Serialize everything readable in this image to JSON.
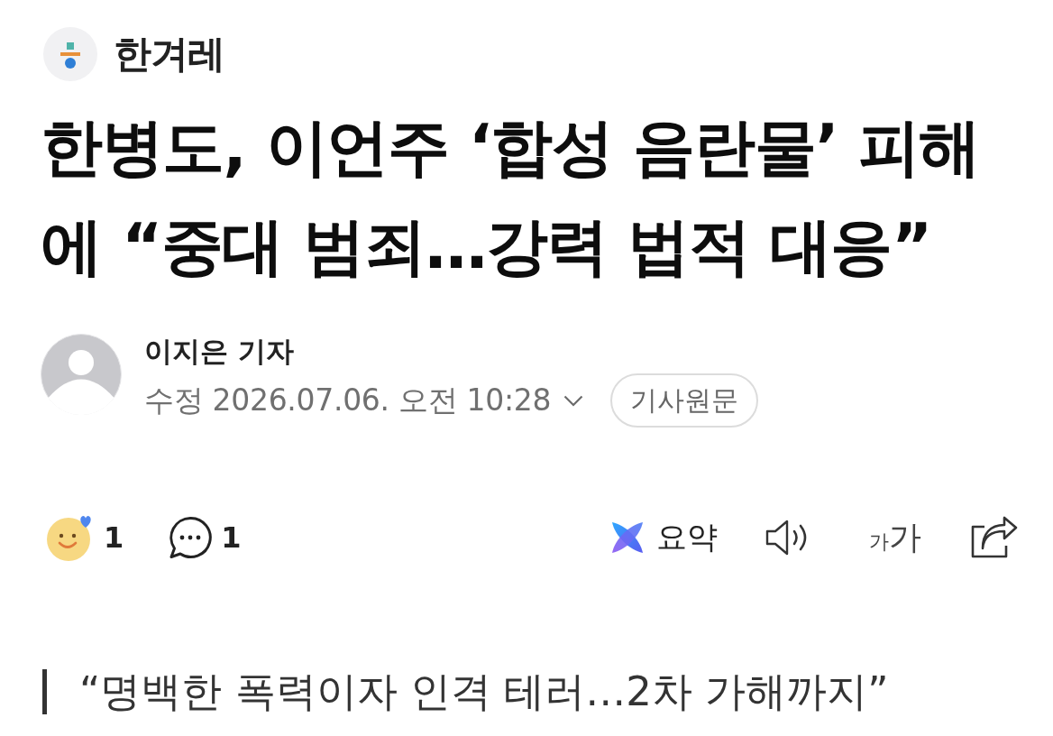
{
  "publisher": {
    "name": "한겨레"
  },
  "headline": "한병도, 이언주 ‘합성 음란물’ 피해에 “중대 범죄…강력 법적 대응”",
  "byline": {
    "author": "이지은 기자",
    "timestamp": "수정 2026.07.06. 오전 10:28",
    "expanded": false,
    "original_button": "기사원문"
  },
  "reactions": {
    "count": "1"
  },
  "comments": {
    "count": "1"
  },
  "tools": [
    {
      "kind": "summary",
      "label": "요약"
    },
    {
      "kind": "listen"
    },
    {
      "kind": "text_size",
      "small": "가",
      "large": "가"
    },
    {
      "kind": "share"
    }
  ],
  "subheading": "“명백한 폭력이자 인격 테러…2차 가해까지”"
}
